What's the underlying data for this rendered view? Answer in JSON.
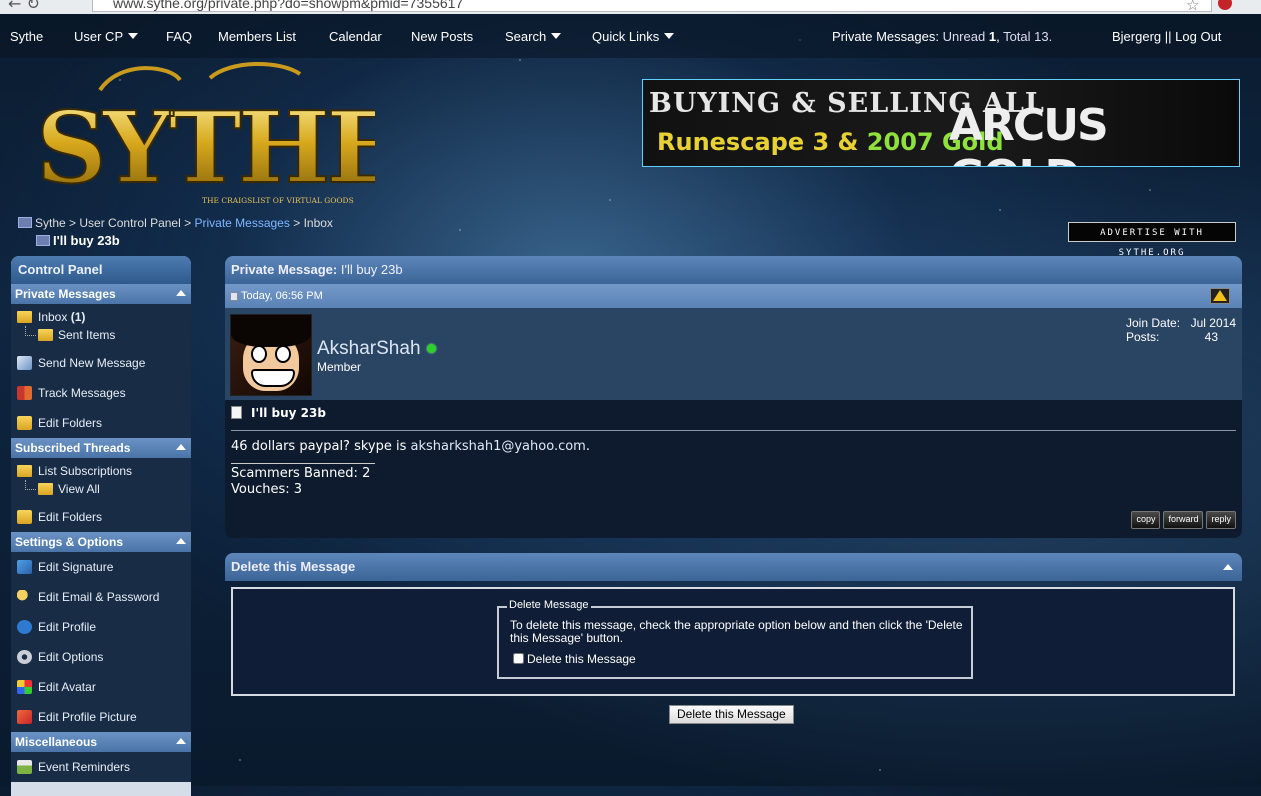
{
  "browser": {
    "url": "www.sythe.org/private.php?do=showpm&pmid=7355617"
  },
  "topnav": {
    "items": [
      "Sythe",
      "User CP",
      "FAQ",
      "Members List",
      "Calendar",
      "New Posts",
      "Search",
      "Quick Links"
    ],
    "pm_label": "Private Messages:",
    "pm_unread_label": "Unread",
    "pm_unread": "1",
    "pm_total_label": "Total",
    "pm_total": "13.",
    "username": "Bjergerg",
    "separator": "||",
    "logout": "Log Out"
  },
  "banner": {
    "line1": "BUYING & SELLING ALL",
    "line2a": "Runescape 3 & ",
    "line2b": "2007 Gold",
    "brand": "ARCUS GOLD"
  },
  "logo": {
    "text": "SYTHE",
    "tagline": "THE CRAIGSLIST OF VIRTUAL GOODS"
  },
  "advertise": "ADVERTISE WITH SYTHE.ORG",
  "breadcrumb": {
    "items": [
      "Sythe",
      "User Control Panel",
      "Private Messages",
      "Inbox"
    ],
    "sep": ">",
    "current": "I'll buy 23b"
  },
  "sidebar": {
    "title": "Control Panel",
    "private_messages": {
      "header": "Private Messages",
      "inbox": "Inbox",
      "inbox_count": "(1)",
      "sent": "Sent Items",
      "send_new": "Send New Message",
      "track": "Track Messages",
      "edit_folders": "Edit Folders"
    },
    "subscribed": {
      "header": "Subscribed Threads",
      "list": "List Subscriptions",
      "view_all": "View All",
      "edit_folders": "Edit Folders"
    },
    "settings": {
      "header": "Settings & Options",
      "signature": "Edit Signature",
      "email": "Edit Email & Password",
      "profile": "Edit Profile",
      "options": "Edit Options",
      "avatar": "Edit Avatar",
      "profile_picture": "Edit Profile Picture"
    },
    "misc": {
      "header": "Miscellaneous",
      "event_reminders": "Event Reminders"
    }
  },
  "message": {
    "panel_title": "Private Message:",
    "panel_subject": "I'll buy 23b",
    "date": "Today, 06:56 PM",
    "user": "AksharShah",
    "role": "Member",
    "join_label": "Join Date:",
    "join_value": "Jul 2014",
    "posts_label": "Posts:",
    "posts_value": "43",
    "subject": "I'll buy 23b",
    "body_prefix": "46 dollars paypal? skype is ",
    "body_email": "aksharkshah1@yahoo.com",
    "body_suffix": ".",
    "sig_line1": "Scammers Banned: 2",
    "sig_line2": "Vouches: 3",
    "actions": [
      "copy",
      "forward",
      "reply"
    ]
  },
  "delete": {
    "header": "Delete this Message",
    "legend": "Delete Message",
    "instructions": "To delete this message, check the appropriate option below and then click the 'Delete this Message' button.",
    "checkbox_label": "Delete this Message",
    "button": "Delete this Message"
  }
}
